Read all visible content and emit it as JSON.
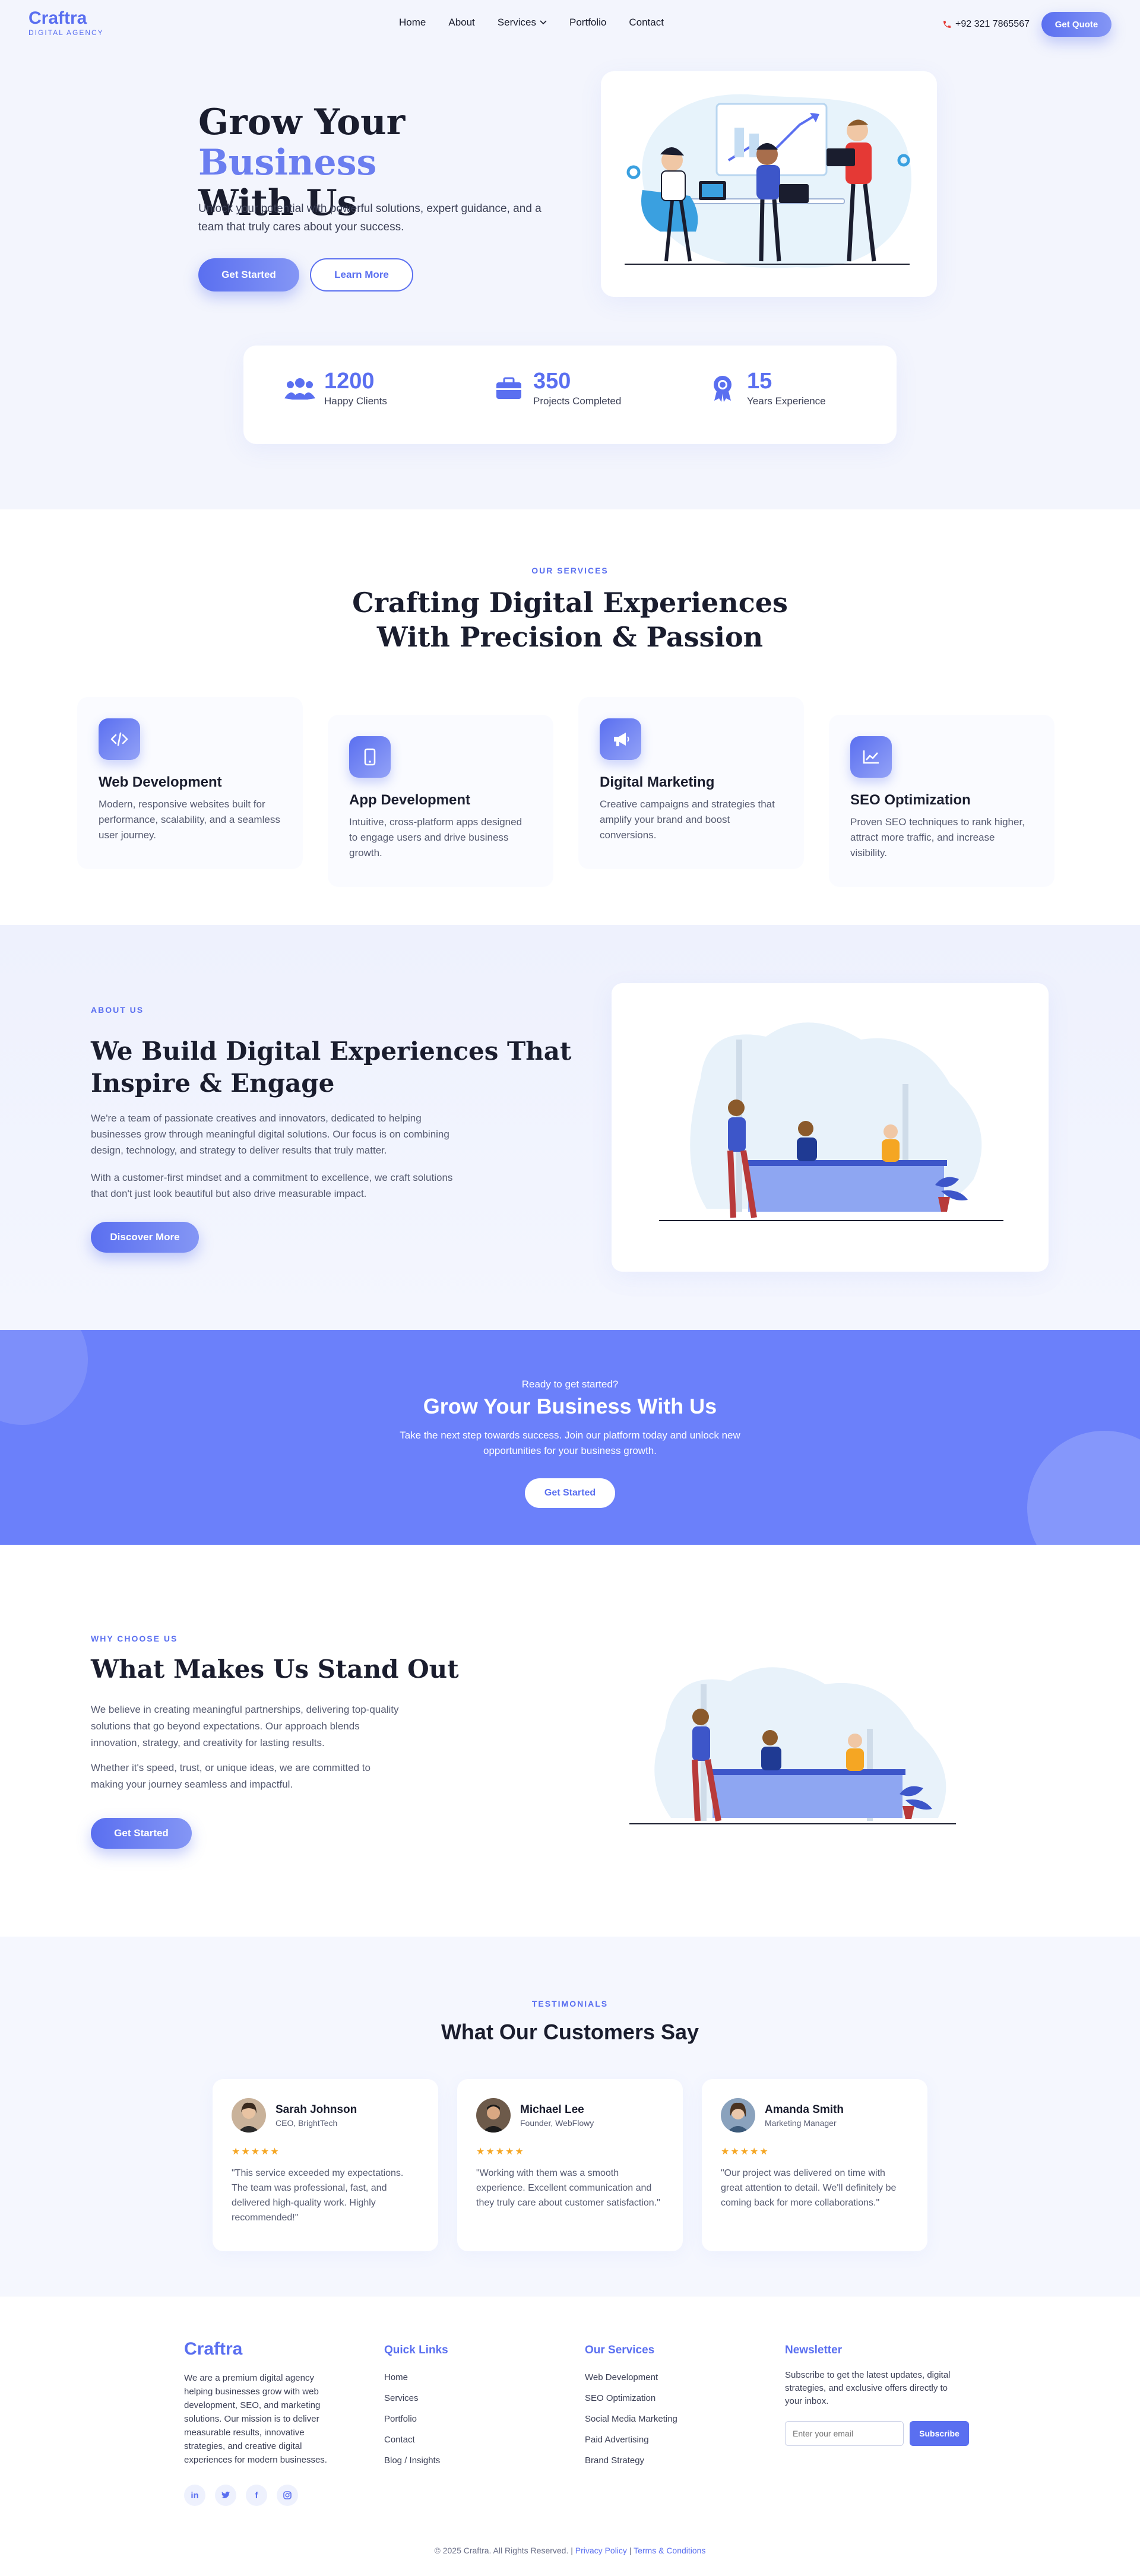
{
  "brand": {
    "name": "Craftra",
    "tagline": "DIGITAL AGENCY",
    "accent": "#5a6ff0"
  },
  "nav": {
    "items": [
      "Home",
      "About",
      "Services",
      "Portfolio",
      "Contact"
    ],
    "phone": "+92 321 7865567",
    "quote_label": "Get Quote"
  },
  "hero": {
    "title_a": "Grow Your ",
    "title_accent": "Business",
    "title_b": "With Us",
    "text": "Unlock your potential with powerful solutions, expert guidance, and a team that truly cares about your success.",
    "primary_label": "Get Started",
    "secondary_label": "Learn More"
  },
  "stats": [
    {
      "value": "1200",
      "label": "Happy Clients",
      "icon": "users-icon"
    },
    {
      "value": "350",
      "label": "Projects Completed",
      "icon": "briefcase-icon"
    },
    {
      "value": "15",
      "label": "Years Experience",
      "icon": "award-icon"
    }
  ],
  "services": {
    "eyebrow": "OUR SERVICES",
    "title_line1": "Crafting Digital Experiences",
    "title_line2": "With Precision & Passion",
    "items": [
      {
        "title": "Web Development",
        "text": "Modern, responsive websites built for performance, scalability, and a seamless user journey.",
        "icon": "code-icon"
      },
      {
        "title": "App Development",
        "text": "Intuitive, cross-platform apps designed to engage users and drive business growth.",
        "icon": "mobile-icon"
      },
      {
        "title": "Digital Marketing",
        "text": "Creative campaigns and strategies that amplify your brand and boost conversions.",
        "icon": "megaphone-icon"
      },
      {
        "title": "SEO Optimization",
        "text": "Proven SEO techniques to rank higher, attract more traffic, and increase visibility.",
        "icon": "chart-icon"
      }
    ]
  },
  "about": {
    "eyebrow": "ABOUT US",
    "title": "We Build Digital Experiences That Inspire & Engage",
    "p1": "We're a team of passionate creatives and innovators, dedicated to helping businesses grow through meaningful digital solutions. Our focus is on combining design, technology, and strategy to deliver results that truly matter.",
    "p2": "With a customer-first mindset and a commitment to excellence, we craft solutions that don't just look beautiful but also drive measurable impact.",
    "button": "Discover More"
  },
  "cta": {
    "pre": "Ready to get started?",
    "title": "Grow Your Business With Us",
    "text": "Take the next step towards success. Join our platform today and unlock new opportunities for your business growth.",
    "button": "Get Started"
  },
  "why": {
    "eyebrow": "WHY CHOOSE US",
    "title": "What Makes Us Stand Out",
    "p1": "We believe in creating meaningful partnerships, delivering top-quality solutions that go beyond expectations. Our approach blends innovation, strategy, and creativity for lasting results.",
    "p2": "Whether it's speed, trust, or unique ideas, we are committed to making your journey seamless and impactful.",
    "button": "Get Started"
  },
  "testimonials": {
    "eyebrow": "TESTIMONIALS",
    "title": "What Our Customers Say",
    "items": [
      {
        "name": "Sarah Johnson",
        "role": "CEO, BrightTech",
        "stars": "★★★★★",
        "quote": "\"This service exceeded my expectations. The team was professional, fast, and delivered high-quality work. Highly recommended!\""
      },
      {
        "name": "Michael Lee",
        "role": "Founder, WebFlowy",
        "stars": "★★★★★",
        "quote": "\"Working with them was a smooth experience. Excellent communication and they truly care about customer satisfaction.\""
      },
      {
        "name": "Amanda Smith",
        "role": "Marketing Manager",
        "stars": "★★★★★",
        "quote": "\"Our project was delivered on time with great attention to detail. We'll definitely be coming back for more collaborations.\""
      }
    ]
  },
  "footer": {
    "about": "We are a premium digital agency helping businesses grow with web development, SEO, and marketing solutions. Our mission is to deliver measurable results, innovative strategies, and creative digital experiences for modern businesses.",
    "socials": [
      "in",
      "tw",
      "f",
      "ig"
    ],
    "quick_title": "Quick Links",
    "quick_links": [
      "Home",
      "Services",
      "Portfolio",
      "Contact",
      "Blog / Insights"
    ],
    "services_title": "Our Services",
    "services_links": [
      "Web Development",
      "SEO Optimization",
      "Social Media Marketing",
      "Paid Advertising",
      "Brand Strategy"
    ],
    "newsletter_title": "Newsletter",
    "newsletter_text": "Subscribe to get the latest updates, digital strategies, and exclusive offers directly to your inbox.",
    "newsletter_placeholder": "Enter your email",
    "subscribe": "Subscribe",
    "copyright": "© 2025 Craftra. All Rights Reserved. | ",
    "privacy": "Privacy Policy",
    "sep": " | ",
    "terms": "Terms & Conditions"
  }
}
